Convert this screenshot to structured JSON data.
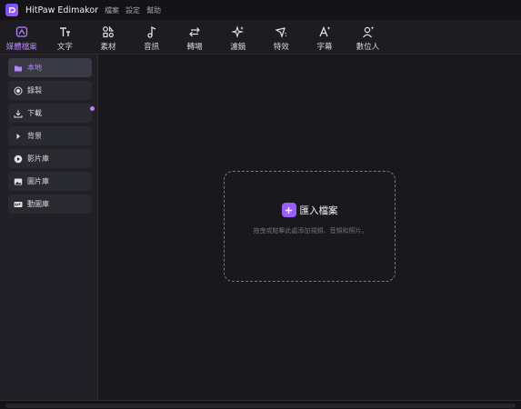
{
  "app": {
    "title": "HitPaw Edimakor",
    "menu": [
      "檔案",
      "設定",
      "幫助"
    ]
  },
  "toolbar": {
    "items": [
      {
        "label": "媒體檔案",
        "icon": "media-files-icon",
        "active": true
      },
      {
        "label": "文字",
        "icon": "text-icon"
      },
      {
        "label": "素材",
        "icon": "elements-icon"
      },
      {
        "label": "音訊",
        "icon": "music-note-icon"
      },
      {
        "label": "轉場",
        "icon": "transition-arrows-icon"
      },
      {
        "label": "濾鏡",
        "icon": "sparkle-filter-icon"
      },
      {
        "label": "特效",
        "icon": "effects-icon"
      },
      {
        "label": "字幕",
        "icon": "subtitle-ai-icon"
      },
      {
        "label": "數位人",
        "icon": "digital-human-icon"
      }
    ]
  },
  "sidebar": {
    "items": [
      {
        "label": "本地",
        "icon": "folder-icon",
        "active": true
      },
      {
        "label": "錄製",
        "icon": "record-icon"
      },
      {
        "label": "下載",
        "icon": "download-icon",
        "badge": true
      },
      {
        "label": "背景",
        "icon": "caret-right-icon"
      },
      {
        "label": "影片庫",
        "icon": "video-library-icon"
      },
      {
        "label": "圖片庫",
        "icon": "image-library-icon"
      },
      {
        "label": "動圖庫",
        "icon": "gif-icon"
      }
    ]
  },
  "dropzone": {
    "import_label": "匯入檔案",
    "hint": "拖曳或點擊此處添加視頻、音頻和照片。"
  },
  "colors": {
    "accent": "#9b5cff",
    "accent_text": "#b784ff",
    "background": "#19191d",
    "sidebar": "#202026"
  }
}
